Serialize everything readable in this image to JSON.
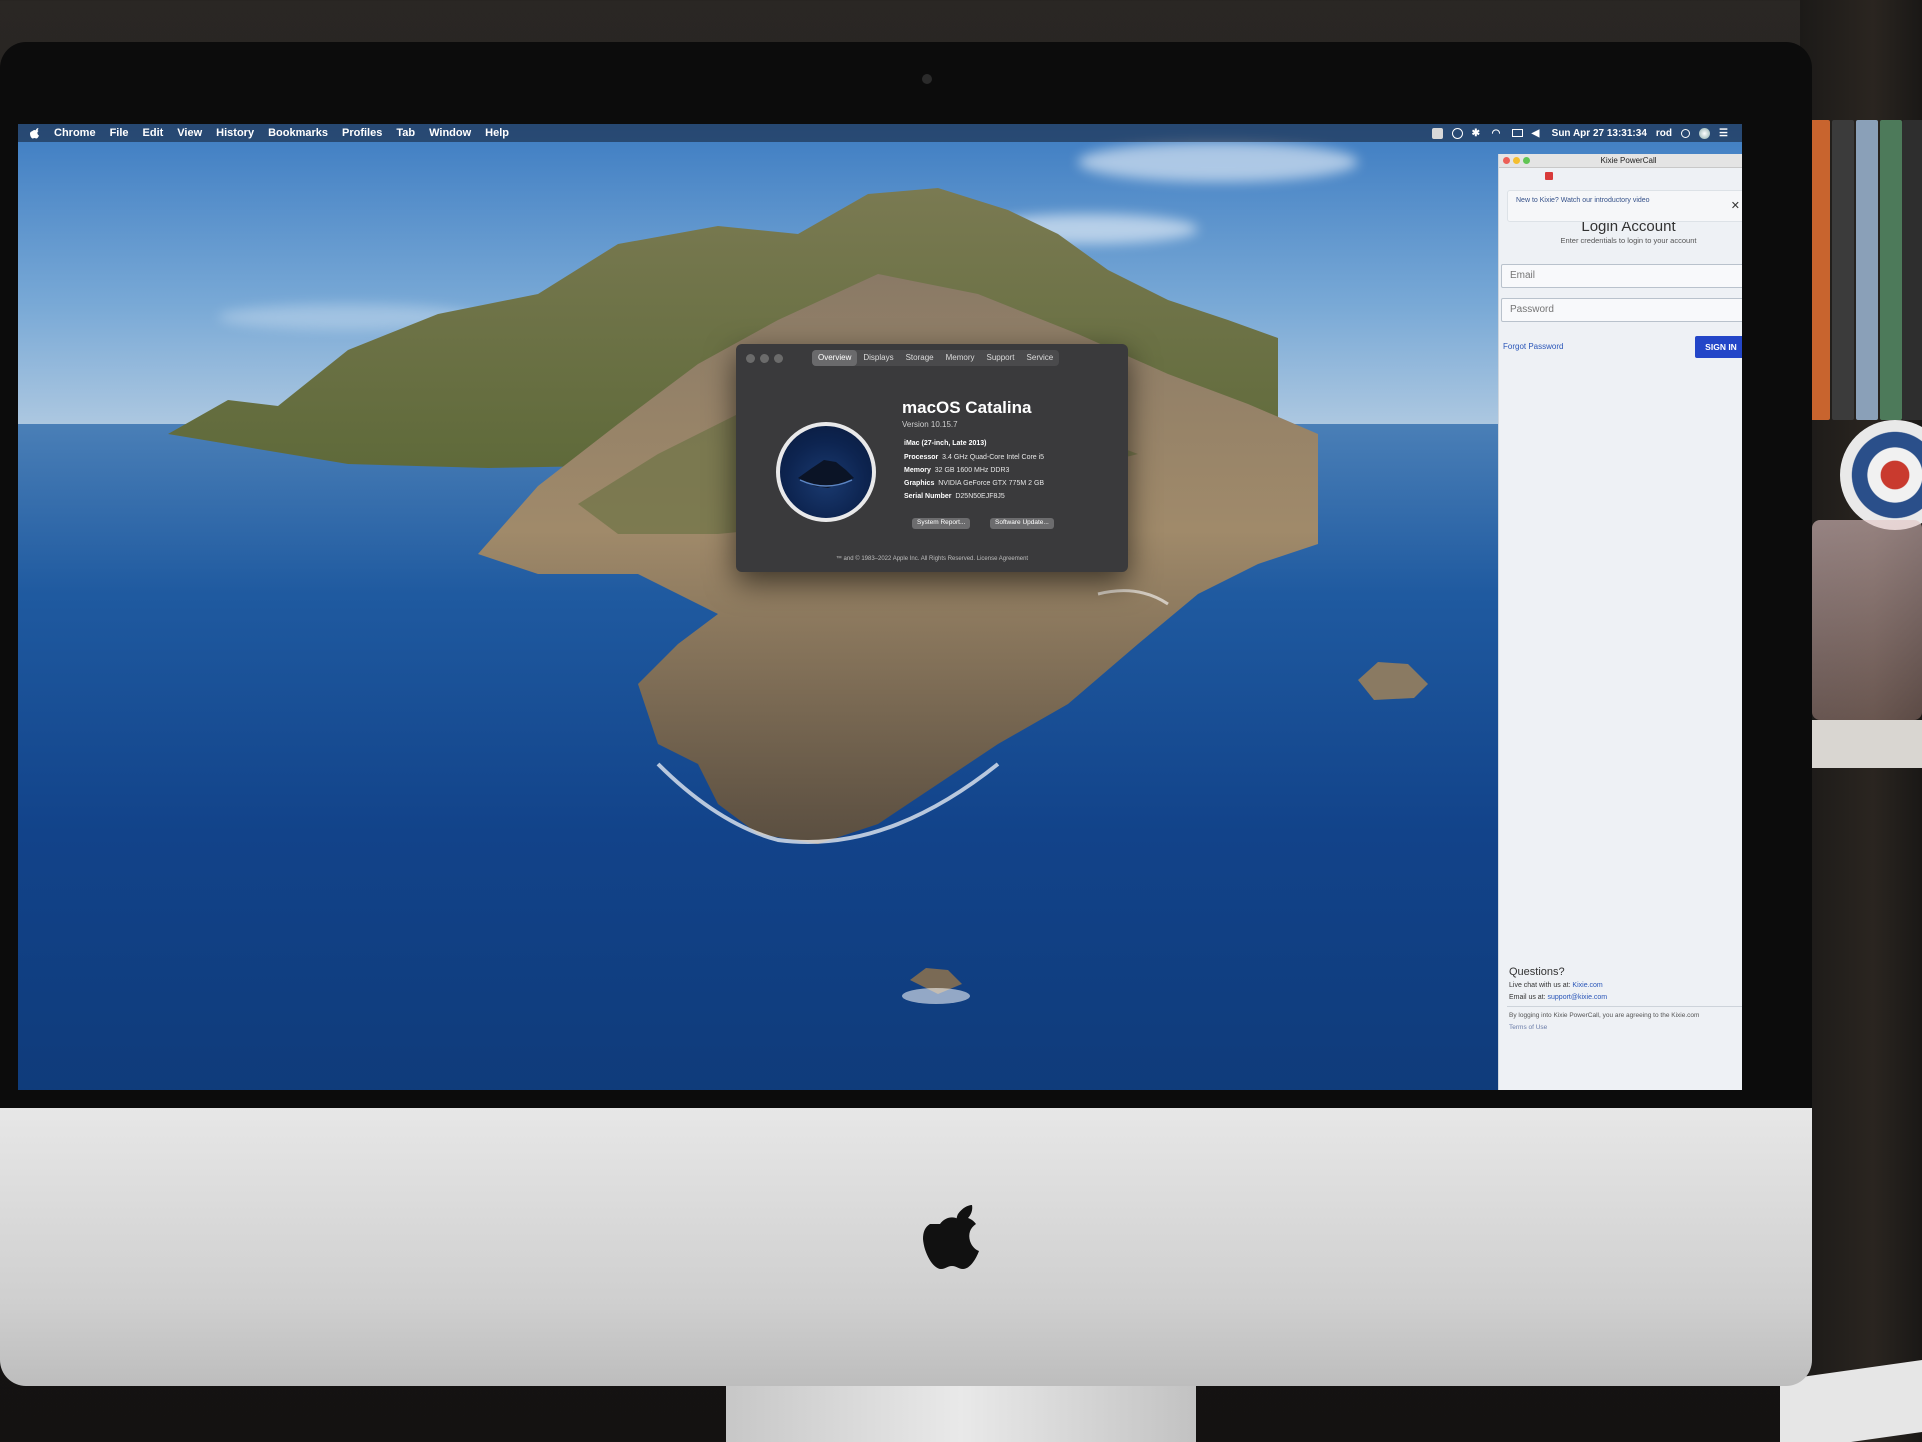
{
  "menubar": {
    "app_name": "Chrome",
    "items": [
      "File",
      "Edit",
      "View",
      "History",
      "Bookmarks",
      "Profiles",
      "Tab",
      "Window",
      "Help"
    ],
    "clock": "Sun Apr 27  13:31:34",
    "user": "rod",
    "status_icons": [
      "evernote-icon",
      "dropbox-icon",
      "bluetooth-icon",
      "wifi-icon",
      "display-icon",
      "volume-icon",
      "search-icon",
      "siri-icon",
      "notification-center-icon"
    ]
  },
  "about_window": {
    "tabs": [
      "Overview",
      "Displays",
      "Storage",
      "Memory",
      "Support",
      "Service"
    ],
    "active_tab": "Overview",
    "os_name": "macOS Catalina",
    "version": "Version 10.15.7",
    "model": "iMac (27-inch, Late 2013)",
    "specs": [
      {
        "label": "Processor",
        "value": "3.4 GHz Quad-Core Intel Core i5"
      },
      {
        "label": "Memory",
        "value": "32 GB 1600 MHz DDR3"
      },
      {
        "label": "Graphics",
        "value": "NVIDIA GeForce GTX 775M 2 GB"
      },
      {
        "label": "Serial Number",
        "value": "D25N50EJF8J5"
      }
    ],
    "system_report_label": "System Report...",
    "software_update_label": "Software Update...",
    "footer": "™ and © 1983–2022 Apple Inc. All Rights Reserved. License Agreement"
  },
  "kixie": {
    "window_title": "Kixie PowerCall",
    "notice": "New to Kixie? Watch our introductory video",
    "login_title": "Login Account",
    "subtitle": "Enter credentials to login to your account",
    "email_placeholder": "Email",
    "password_placeholder": "Password",
    "forgot_password": "Forgot Password",
    "sign_in": "SIGN IN",
    "questions": "Questions?",
    "live_chat_prefix": "Live chat with us at: ",
    "live_chat_link": "Kixie.com",
    "email_prefix": "Email us at: ",
    "email_link": "support@kixie.com",
    "terms_text": "By logging into Kixie PowerCall, you are agreeing to the Kixie.com",
    "terms_link": "Terms of Use"
  },
  "colors": {
    "sign_in_button": "#2346c8",
    "link": "#2a56b8",
    "about_bg": "#3a3a3c"
  }
}
